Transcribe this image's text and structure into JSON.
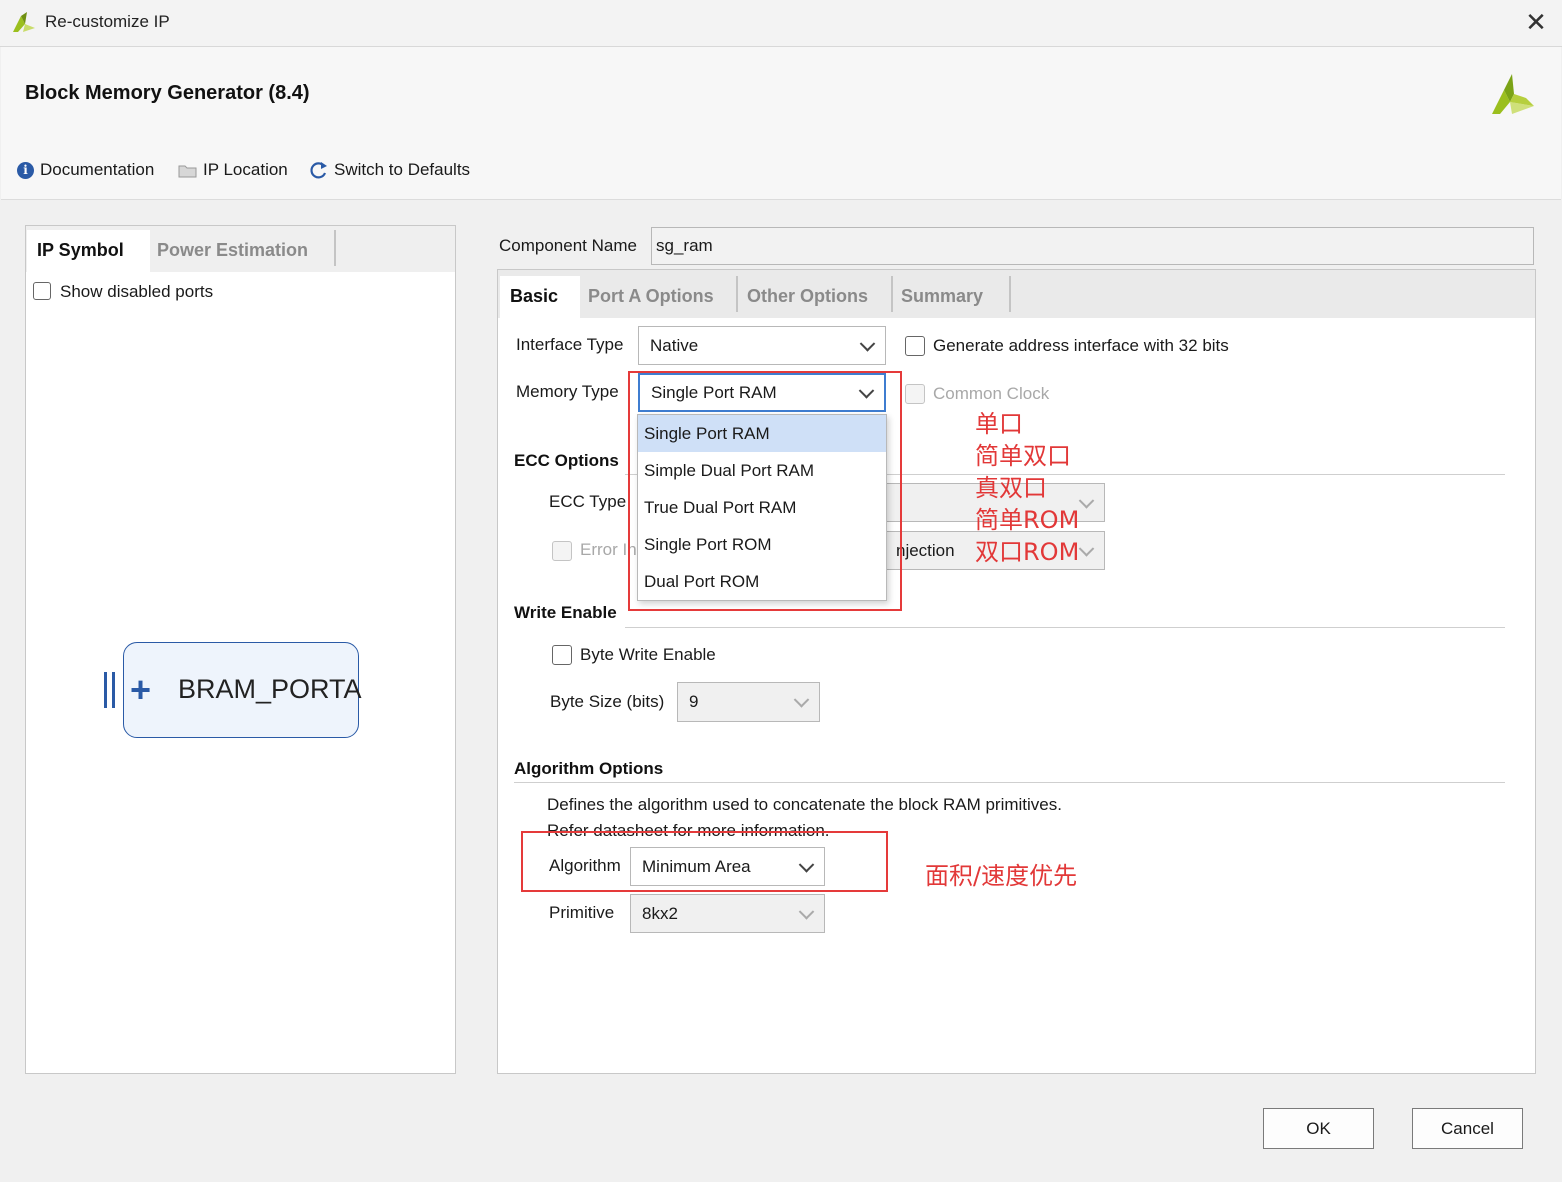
{
  "window": {
    "title": "Re-customize IP",
    "close_symbol": "✕"
  },
  "header": {
    "heading": "Block Memory Generator (8.4)"
  },
  "toolbar": {
    "documentation": "Documentation",
    "ip_location": "IP Location",
    "switch_defaults": "Switch to Defaults"
  },
  "left": {
    "tabs": [
      "IP Symbol",
      "Power Estimation"
    ],
    "show_disabled_ports": "Show disabled ports",
    "symbol": {
      "port_label": "BRAM_PORTA"
    }
  },
  "component": {
    "label": "Component Name",
    "value": "sg_ram"
  },
  "tabs": [
    "Basic",
    "Port A Options",
    "Other Options",
    "Summary"
  ],
  "basic": {
    "interface_type_label": "Interface Type",
    "interface_type_value": "Native",
    "gen_address_label": "Generate address interface with 32 bits",
    "memory_type_label": "Memory Type",
    "memory_type_value": "Single Port RAM",
    "common_clock_label": "Common Clock",
    "memory_type_options": [
      "Single Port RAM",
      "Simple Dual Port RAM",
      "True Dual Port RAM",
      "Single Port ROM",
      "Dual Port ROM"
    ],
    "ecc_section": "ECC Options",
    "ecc_type_label": "ECC Type",
    "error_label_visible": "Error In",
    "injection_visible": "njection",
    "write_enable_section": "Write Enable",
    "byte_write_enable_label": "Byte Write Enable",
    "byte_size_label": "Byte Size (bits)",
    "byte_size_value": "9",
    "algorithm_section": "Algorithm Options",
    "algorithm_desc_1": "Defines the algorithm used to concatenate the block RAM primitives.",
    "algorithm_desc_2": "Refer datasheet for more information.",
    "algorithm_label": "Algorithm",
    "algorithm_value": "Minimum Area",
    "primitive_label": "Primitive",
    "primitive_value": "8kx2"
  },
  "annotations": {
    "memory_types": [
      "单口",
      "简单双口",
      "真双口",
      "简单ROM",
      "双口ROM"
    ],
    "algorithm": "面积/速度优先"
  },
  "buttons": {
    "ok": "OK",
    "cancel": "Cancel"
  },
  "colors": {
    "annotation_red": "#e53a3a",
    "selected_item": "#cfe0f7",
    "brand_green": "#9bbf1e"
  }
}
